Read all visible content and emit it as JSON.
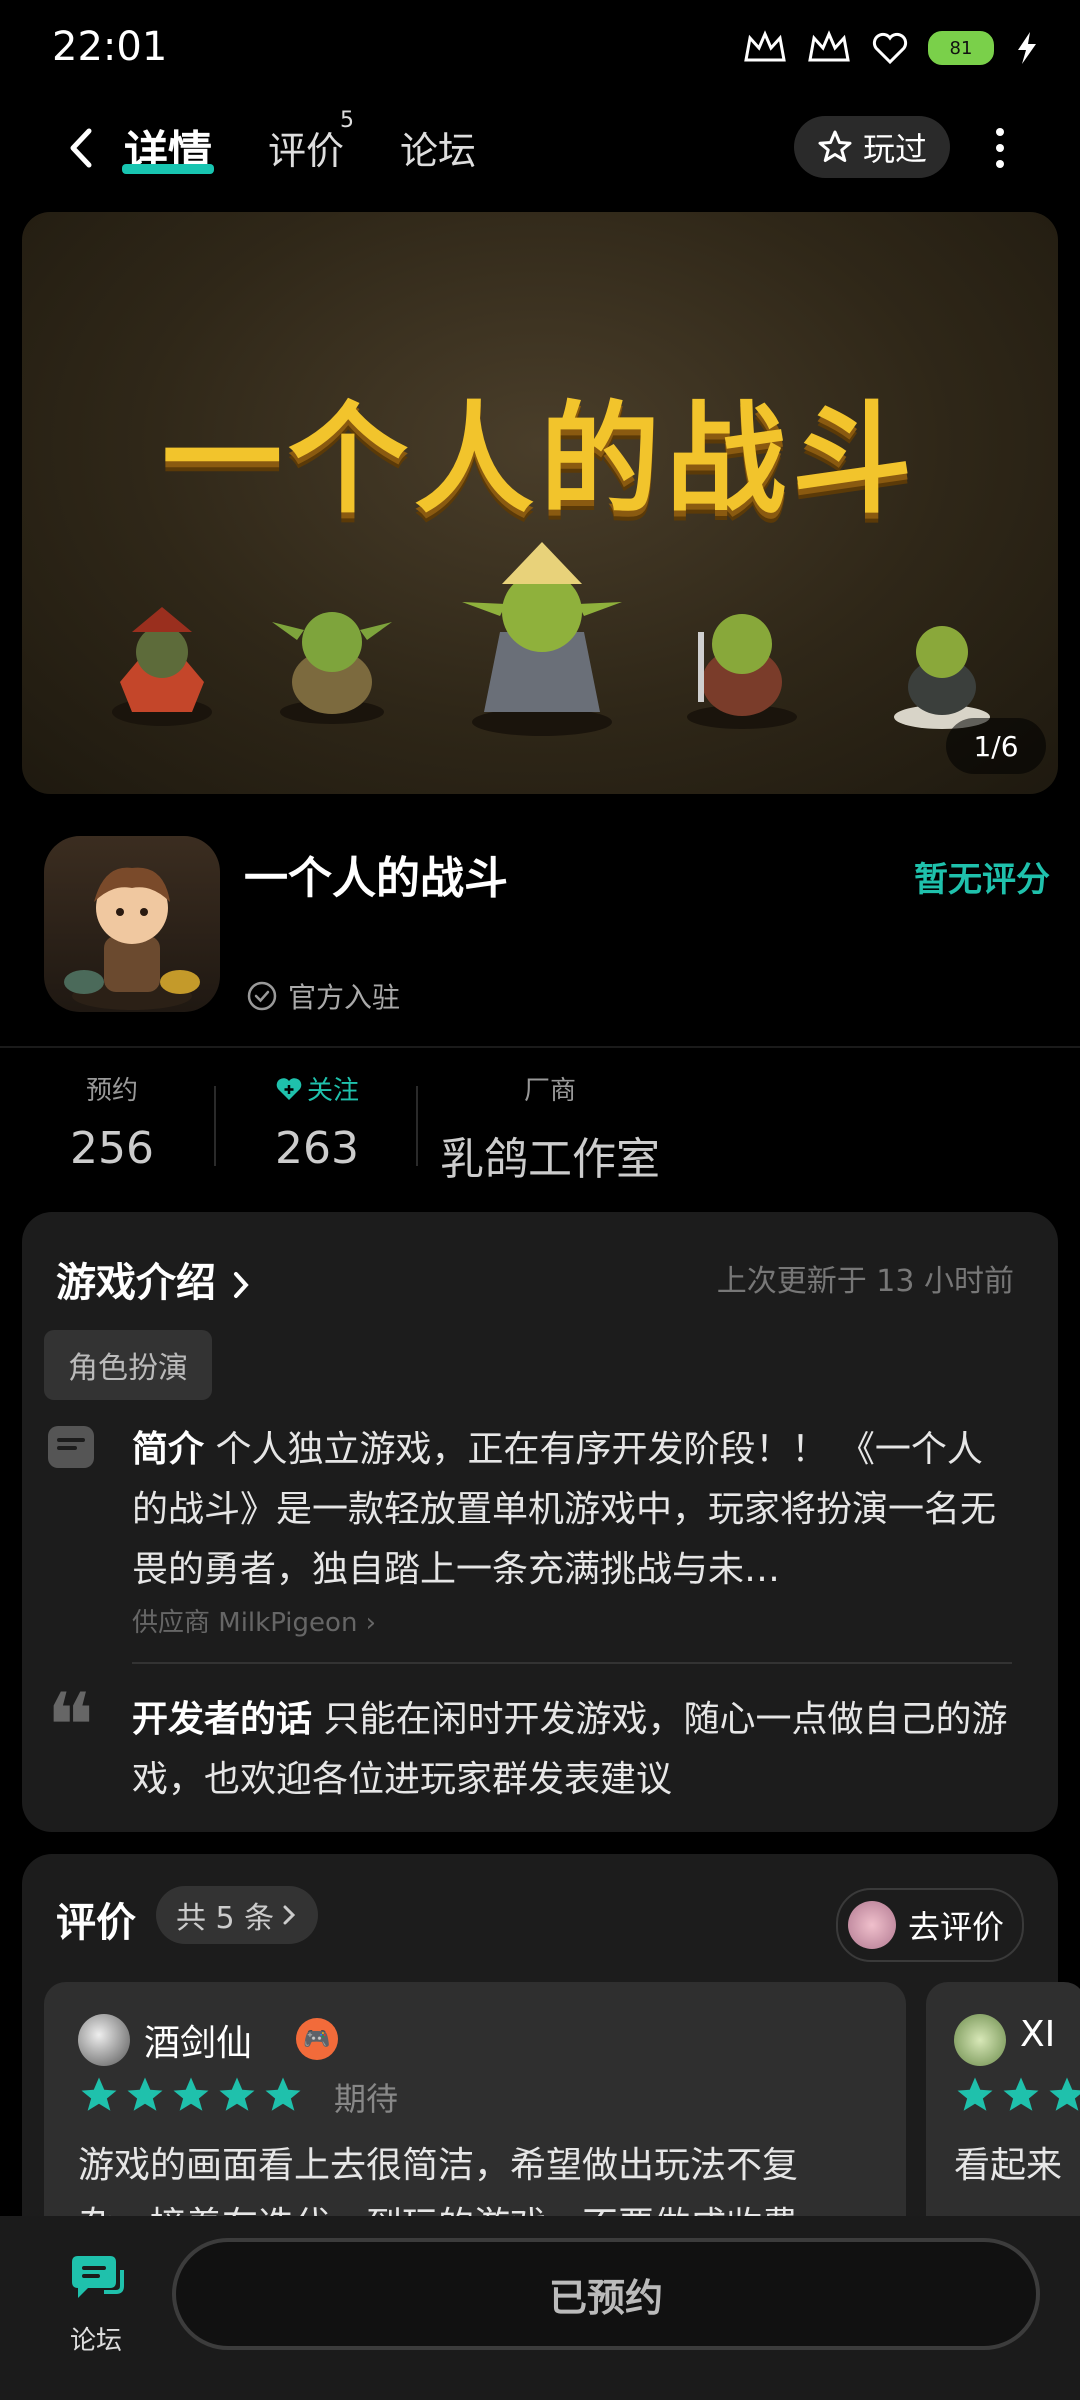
{
  "status_bar": {
    "time": "22:01",
    "battery": "81"
  },
  "nav": {
    "tabs": [
      {
        "label": "详情"
      },
      {
        "label": "评价",
        "badge": "5"
      },
      {
        "label": "论坛"
      }
    ],
    "played_label": "玩过"
  },
  "banner": {
    "title": "一个人的战斗",
    "counter": "1/6"
  },
  "game": {
    "name": "一个人的战斗",
    "rating": "暂无评分",
    "official": "官方入驻"
  },
  "stats": {
    "reserve_label": "预约",
    "reserve_value": "256",
    "follow_label": "关注",
    "follow_value": "263",
    "vendor_label": "厂商",
    "vendor_value": "乳鸽工作室"
  },
  "intro": {
    "title": "游戏介绍",
    "updated": "上次更新于 13 小时前",
    "tag": "角色扮演",
    "desc_label": "简介",
    "desc_text": "个人独立游戏，正在有序开发阶段！！ 《一个人的战斗》是一款轻放置单机游戏中，玩家将扮演一名无畏的勇者，独自踏上一条充满挑战与未…",
    "supplier": "供应商 MilkPigeon",
    "dev_label": "开发者的话",
    "dev_text": "只能在闲时开发游戏，随心一点做自己的游戏，也欢迎各位进玩家群发表建议"
  },
  "reviews": {
    "title": "评价",
    "count": "共 5 条",
    "go_review": "去评价",
    "items": [
      {
        "name": "酒剑仙",
        "status": "期待",
        "text": "游戏的画面看上去很简洁，希望做出玩法不复杂，接着在迭代，到玩的游戏，不要做成收费"
      },
      {
        "name": "XI",
        "text": "看起来"
      }
    ]
  },
  "bottom": {
    "forum_label": "论坛",
    "reserve_button": "已预约"
  },
  "colors": {
    "accent": "#1fc1ac",
    "background": "#000000",
    "card": "#1c1c1c"
  }
}
